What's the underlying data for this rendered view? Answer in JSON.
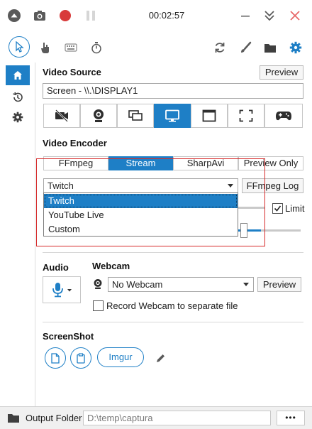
{
  "titlebar": {
    "timer": "00:02:57"
  },
  "colors": {
    "accent": "#1e7fc6",
    "record": "#d83b3b",
    "close": "#e86a6a",
    "highlight_box": "#d62b2b"
  },
  "video_source": {
    "title": "Video Source",
    "preview_label": "Preview",
    "value": "Screen - \\\\.\\DISPLAY1"
  },
  "video_encoder": {
    "title": "Video Encoder",
    "tabs": [
      "FFmpeg",
      "Stream",
      "SharpAvi",
      "Preview Only"
    ],
    "active_tab": "Stream",
    "selected": "Twitch",
    "options": [
      "Twitch",
      "YouTube Live",
      "Custom"
    ],
    "ffmpeg_log_label": "FFmpeg Log",
    "limit_label": "Limit"
  },
  "audio": {
    "title": "Audio"
  },
  "webcam": {
    "title": "Webcam",
    "selected": "No Webcam",
    "preview_label": "Preview",
    "separate_file_label": "Record Webcam to separate file"
  },
  "screenshot": {
    "title": "ScreenShot",
    "imgur_label": "Imgur"
  },
  "output": {
    "folder_label": "Output Folder",
    "path": "D:\\temp\\captura",
    "more_label": "•••"
  }
}
